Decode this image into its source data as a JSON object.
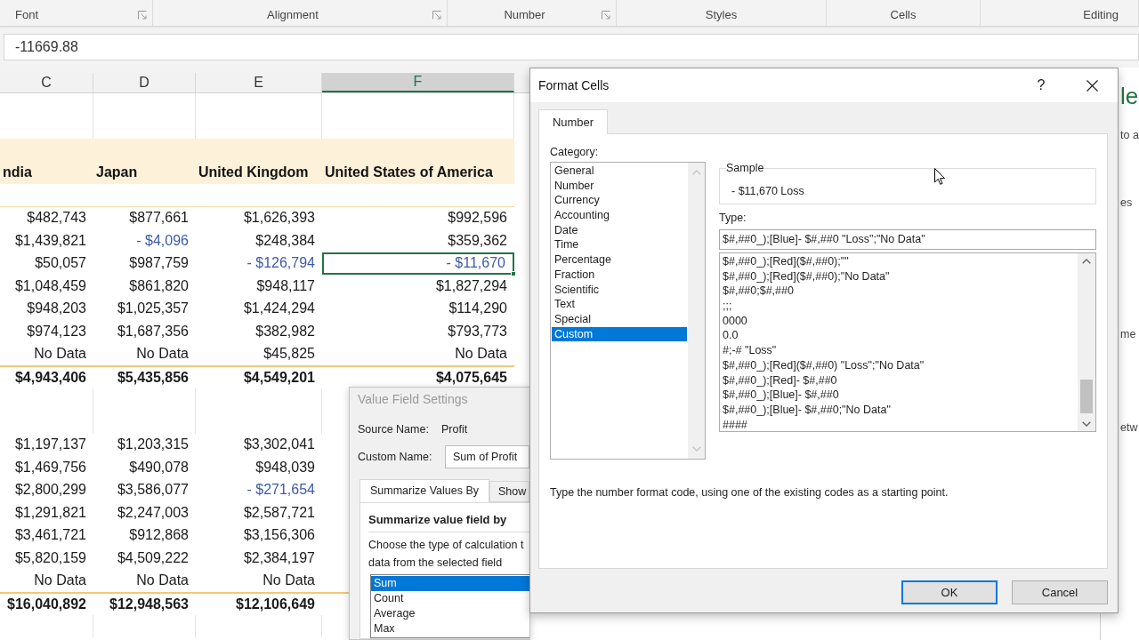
{
  "ribbon": {
    "groups": [
      {
        "label": "Font",
        "launcher": true
      },
      {
        "label": "Alignment",
        "launcher": true
      },
      {
        "label": "Number",
        "launcher": true
      },
      {
        "label": "Styles",
        "launcher": false
      },
      {
        "label": "Cells",
        "launcher": false
      },
      {
        "label": "Editing",
        "launcher": false
      }
    ]
  },
  "formula_bar": {
    "value": "-11669.88"
  },
  "sheet": {
    "columns": [
      {
        "label": "C",
        "selected": false
      },
      {
        "label": "D",
        "selected": false
      },
      {
        "label": "E",
        "selected": false
      },
      {
        "label": "F",
        "selected": true
      }
    ],
    "rows": [
      {
        "kind": "blank"
      },
      {
        "kind": "blank"
      },
      {
        "kind": "header",
        "cells": [
          {
            "text": "ndia",
            "negative": false,
            "selected": false
          },
          {
            "text": "Japan",
            "negative": false,
            "selected": false
          },
          {
            "text": "United Kingdom",
            "negative": false,
            "selected": false
          },
          {
            "text": "United States of America",
            "negative": false,
            "selected": false
          }
        ]
      },
      {
        "kind": "spacer"
      },
      {
        "kind": "data",
        "cells": [
          {
            "text": "$482,743",
            "negative": false,
            "selected": false
          },
          {
            "text": "$877,661",
            "negative": false,
            "selected": false
          },
          {
            "text": "$1,626,393",
            "negative": false,
            "selected": false
          },
          {
            "text": "$992,596",
            "negative": false,
            "selected": false
          }
        ]
      },
      {
        "kind": "data",
        "cells": [
          {
            "text": "$1,439,821",
            "negative": false,
            "selected": false
          },
          {
            "text": "- $4,096",
            "negative": true,
            "selected": false
          },
          {
            "text": "$248,384",
            "negative": false,
            "selected": false
          },
          {
            "text": "$359,362",
            "negative": false,
            "selected": false
          }
        ]
      },
      {
        "kind": "data",
        "cells": [
          {
            "text": "$50,057",
            "negative": false,
            "selected": false
          },
          {
            "text": "$987,759",
            "negative": false,
            "selected": false
          },
          {
            "text": "- $126,794",
            "negative": true,
            "selected": false
          },
          {
            "text": "- $11,670",
            "negative": true,
            "selected": true
          }
        ]
      },
      {
        "kind": "data",
        "cells": [
          {
            "text": "$1,048,459",
            "negative": false,
            "selected": false
          },
          {
            "text": "$861,820",
            "negative": false,
            "selected": false
          },
          {
            "text": "$948,117",
            "negative": false,
            "selected": false
          },
          {
            "text": "$1,827,294",
            "negative": false,
            "selected": false
          }
        ]
      },
      {
        "kind": "data",
        "cells": [
          {
            "text": "$948,203",
            "negative": false,
            "selected": false
          },
          {
            "text": "$1,025,357",
            "negative": false,
            "selected": false
          },
          {
            "text": "$1,424,294",
            "negative": false,
            "selected": false
          },
          {
            "text": "$114,290",
            "negative": false,
            "selected": false
          }
        ]
      },
      {
        "kind": "data",
        "cells": [
          {
            "text": "$974,123",
            "negative": false,
            "selected": false
          },
          {
            "text": "$1,687,356",
            "negative": false,
            "selected": false
          },
          {
            "text": "$382,982",
            "negative": false,
            "selected": false
          },
          {
            "text": "$793,773",
            "negative": false,
            "selected": false
          }
        ]
      },
      {
        "kind": "data",
        "cells": [
          {
            "text": "No Data",
            "negative": false,
            "selected": false
          },
          {
            "text": "No Data",
            "negative": false,
            "selected": false
          },
          {
            "text": "$45,825",
            "negative": false,
            "selected": false
          },
          {
            "text": "No Data",
            "negative": false,
            "selected": false
          }
        ]
      },
      {
        "kind": "total",
        "cells": [
          {
            "text": "$4,943,406",
            "negative": false,
            "selected": false
          },
          {
            "text": "$5,435,856",
            "negative": false,
            "selected": false
          },
          {
            "text": "$4,549,201",
            "negative": false,
            "selected": false
          },
          {
            "text": "$4,075,645",
            "negative": false,
            "selected": false
          }
        ]
      },
      {
        "kind": "blank"
      },
      {
        "kind": "blank"
      },
      {
        "kind": "data",
        "cells": [
          {
            "text": "$1,197,137",
            "negative": false,
            "selected": false
          },
          {
            "text": "$1,203,315",
            "negative": false,
            "selected": false
          },
          {
            "text": "$3,302,041",
            "negative": false,
            "selected": false
          }
        ]
      },
      {
        "kind": "data",
        "cells": [
          {
            "text": "$1,469,756",
            "negative": false,
            "selected": false
          },
          {
            "text": "$490,078",
            "negative": false,
            "selected": false
          },
          {
            "text": "$948,039",
            "negative": false,
            "selected": false
          }
        ]
      },
      {
        "kind": "data",
        "cells": [
          {
            "text": "$2,800,299",
            "negative": false,
            "selected": false
          },
          {
            "text": "$3,586,077",
            "negative": false,
            "selected": false
          },
          {
            "text": "- $271,654",
            "negative": true,
            "selected": false
          }
        ]
      },
      {
        "kind": "data",
        "cells": [
          {
            "text": "$1,291,821",
            "negative": false,
            "selected": false
          },
          {
            "text": "$2,247,003",
            "negative": false,
            "selected": false
          },
          {
            "text": "$2,587,721",
            "negative": false,
            "selected": false
          }
        ]
      },
      {
        "kind": "data",
        "cells": [
          {
            "text": "$3,461,721",
            "negative": false,
            "selected": false
          },
          {
            "text": "$912,868",
            "negative": false,
            "selected": false
          },
          {
            "text": "$3,156,306",
            "negative": false,
            "selected": false
          }
        ]
      },
      {
        "kind": "data",
        "cells": [
          {
            "text": "$5,820,159",
            "negative": false,
            "selected": false
          },
          {
            "text": "$4,509,222",
            "negative": false,
            "selected": false
          },
          {
            "text": "$2,384,197",
            "negative": false,
            "selected": false
          }
        ]
      },
      {
        "kind": "data",
        "cells": [
          {
            "text": "No Data",
            "negative": false,
            "selected": false
          },
          {
            "text": "No Data",
            "negative": false,
            "selected": false
          },
          {
            "text": "No Data",
            "negative": false,
            "selected": false
          }
        ]
      },
      {
        "kind": "total",
        "cells": [
          {
            "text": "$16,040,892",
            "negative": false,
            "selected": false
          },
          {
            "text": "$12,948,563",
            "negative": false,
            "selected": false
          },
          {
            "text": "$12,106,649",
            "negative": false,
            "selected": false
          }
        ]
      },
      {
        "kind": "blank"
      }
    ]
  },
  "task_pane": {
    "fragments": [
      {
        "text": "le",
        "kind": "heading"
      },
      {
        "text": "to a",
        "kind": "body"
      },
      {
        "text": "es",
        "kind": "body"
      },
      {
        "text": "me",
        "kind": "body"
      },
      {
        "text": "etw",
        "kind": "body"
      }
    ]
  },
  "value_field_settings": {
    "title": "Value Field Settings",
    "source_label": "Source Name:",
    "source_value": "Profit",
    "custom_label": "Custom Name:",
    "custom_value": "Sum of Profit",
    "tabs": [
      {
        "label": "Summarize Values By",
        "selected": true
      },
      {
        "label": "Show",
        "selected": false
      }
    ],
    "section_title": "Summarize value field by",
    "instructions": [
      "Choose the type of calculation t",
      "data from the selected field"
    ],
    "functions": [
      {
        "label": "Sum",
        "selected": true
      },
      {
        "label": "Count",
        "selected": false
      },
      {
        "label": "Average",
        "selected": false
      },
      {
        "label": "Max",
        "selected": false
      }
    ]
  },
  "format_cells": {
    "title": "Format Cells",
    "help": "?",
    "tabs": [
      {
        "label": "Number",
        "selected": true
      }
    ],
    "category_label": "Category:",
    "categories": [
      {
        "label": "General",
        "selected": false
      },
      {
        "label": "Number",
        "selected": false
      },
      {
        "label": "Currency",
        "selected": false
      },
      {
        "label": "Accounting",
        "selected": false
      },
      {
        "label": "Date",
        "selected": false
      },
      {
        "label": "Time",
        "selected": false
      },
      {
        "label": "Percentage",
        "selected": false
      },
      {
        "label": "Fraction",
        "selected": false
      },
      {
        "label": "Scientific",
        "selected": false
      },
      {
        "label": "Text",
        "selected": false
      },
      {
        "label": "Special",
        "selected": false
      },
      {
        "label": "Custom",
        "selected": true
      }
    ],
    "sample_label": "Sample",
    "sample_value": "- $11,670 Loss",
    "type_label": "Type:",
    "type_value": "$#,##0_);[Blue]- $#,##0 \"Loss\";\"No Data\"",
    "format_codes": [
      {
        "code": "$#,##0_);[Red]($#,##0);\"\"",
        "selected": false
      },
      {
        "code": "$#,##0_);[Red]($#,##0);\"No Data\"",
        "selected": false
      },
      {
        "code": "$#,##0;$#,##0",
        "selected": false
      },
      {
        "code": ";;;",
        "selected": false
      },
      {
        "code": "0000",
        "selected": false
      },
      {
        "code": "0.0",
        "selected": false
      },
      {
        "code": "#;-# \"Loss\"",
        "selected": false
      },
      {
        "code": "$#,##0_);[Red]($#,##0) \"Loss\";\"No Data\"",
        "selected": false
      },
      {
        "code": "$#,##0_);[Red]- $#,##0",
        "selected": false
      },
      {
        "code": "$#,##0_);[Blue]- $#,##0",
        "selected": false
      },
      {
        "code": "$#,##0_);[Blue]- $#,##0;\"No Data\"",
        "selected": false
      },
      {
        "code": "####",
        "selected": false
      }
    ],
    "description": "Type the number format code, using one of the existing codes as a starting point.",
    "buttons": [
      {
        "label": "OK",
        "default": true
      },
      {
        "label": "Cancel",
        "default": false
      }
    ]
  }
}
